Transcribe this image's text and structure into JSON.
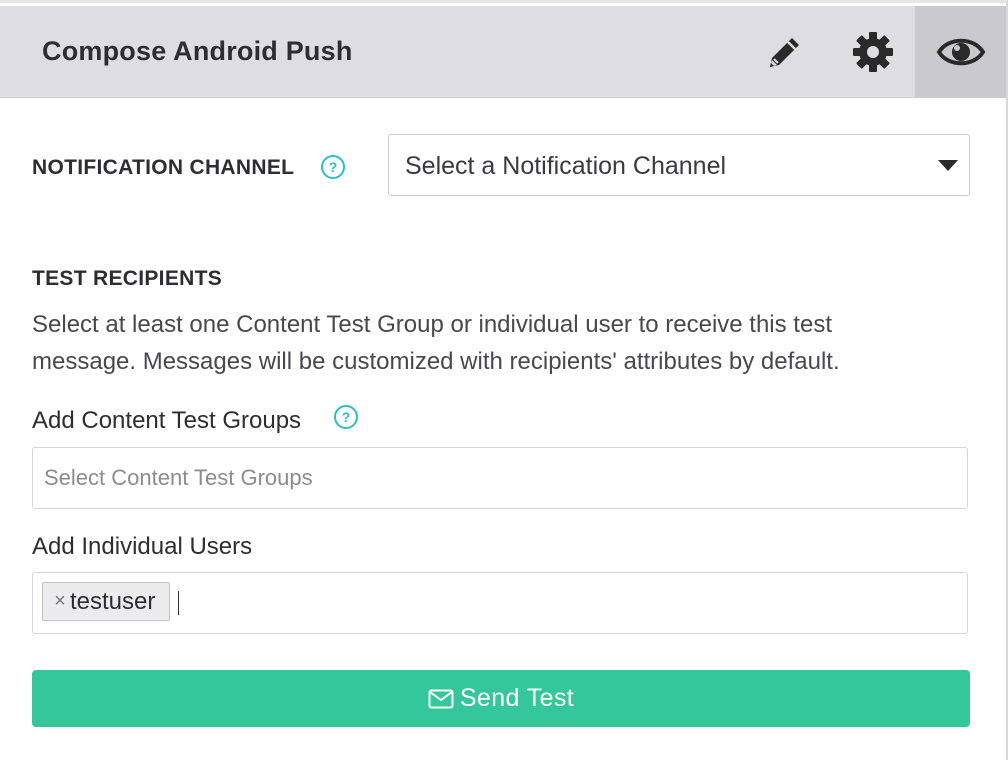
{
  "header": {
    "title": "Compose Android Push",
    "icons": [
      "pencil-icon",
      "gear-icon",
      "eye-icon"
    ],
    "active_icon": "eye-icon"
  },
  "notification_channel": {
    "label": "NOTIFICATION CHANNEL",
    "help": "?",
    "value": "Select a Notification Channel"
  },
  "test_recipients": {
    "heading": "TEST RECIPIENTS",
    "description_line1": "Select at least one Content Test Group or individual user to receive this test",
    "description_line2": "message. Messages will be customized with recipients' attributes by default.",
    "groups": {
      "label": "Add Content Test Groups",
      "help": "?",
      "placeholder": "Select Content Test Groups"
    },
    "users": {
      "label": "Add Individual Users",
      "tags": [
        {
          "remove": "×",
          "name": "testuser"
        }
      ]
    }
  },
  "send_button": {
    "label": "Send Test",
    "icon": "envelope-icon"
  },
  "colors": {
    "header_bg": "#dedee2",
    "active_tab_bg": "#c9c9ce",
    "accent": "#2bbec5",
    "send_bg": "#33c79a"
  }
}
